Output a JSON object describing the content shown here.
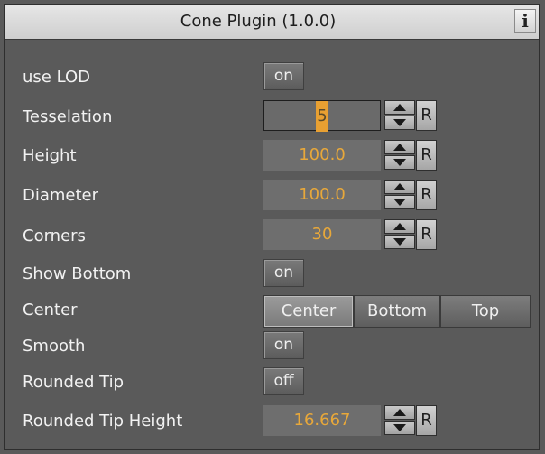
{
  "window": {
    "title": "Cone Plugin (1.0.0)",
    "info_button": "i"
  },
  "rows": {
    "use_lod": {
      "label": "use LOD",
      "value": "on"
    },
    "tesselation": {
      "label": "Tesselation",
      "value": "5",
      "reset": "R"
    },
    "height": {
      "label": "Height",
      "value": "100.0",
      "reset": "R"
    },
    "diameter": {
      "label": "Diameter",
      "value": "100.0",
      "reset": "R"
    },
    "corners": {
      "label": "Corners",
      "value": "30",
      "reset": "R"
    },
    "show_bottom": {
      "label": "Show Bottom",
      "value": "on"
    },
    "center": {
      "label": "Center",
      "options": [
        "Center",
        "Bottom",
        "Top"
      ],
      "selected": "Center"
    },
    "smooth": {
      "label": "Smooth",
      "value": "on"
    },
    "rounded_tip": {
      "label": "Rounded Tip",
      "value": "off"
    },
    "rounded_tip_height": {
      "label": "Rounded Tip Height",
      "value": "16.667",
      "reset": "R"
    }
  },
  "icons": {
    "spinner_up": "triangle-up-icon",
    "spinner_down": "triangle-down-icon",
    "info": "info-icon"
  },
  "colors": {
    "panel_bg": "#5a5a5a",
    "value_text": "#e8a83a",
    "label_text": "#f2f2f2",
    "titlebar": "#d9d9d9"
  }
}
